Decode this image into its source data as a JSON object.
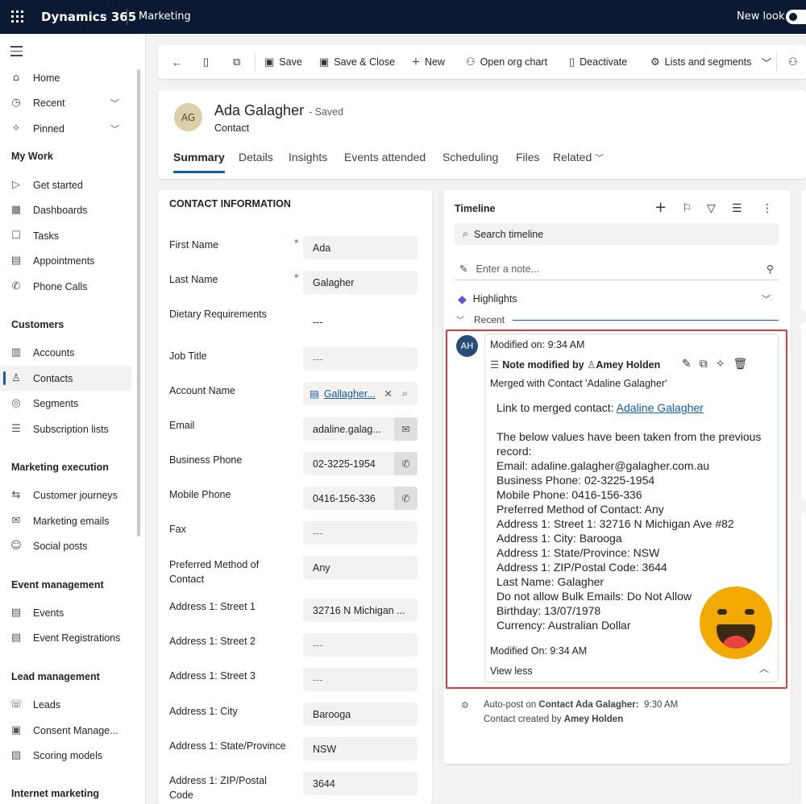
{
  "topbar": {
    "brand": "Dynamics 365",
    "app": "Marketing",
    "new_look": "New look"
  },
  "nav": {
    "items": [
      {
        "label": "Home",
        "icon": "home-icon"
      },
      {
        "label": "Recent",
        "icon": "clock-icon"
      },
      {
        "label": "Pinned",
        "icon": "pin-icon"
      }
    ],
    "groups": {
      "my_work": "My Work",
      "customers": "Customers",
      "marketing_execution": "Marketing execution",
      "event_management": "Event management",
      "lead_management": "Lead management",
      "internet_marketing": "Internet marketing"
    },
    "my_work": [
      "Get started",
      "Dashboards",
      "Tasks",
      "Appointments",
      "Phone Calls"
    ],
    "customers": [
      "Accounts",
      "Contacts",
      "Segments",
      "Subscription lists"
    ],
    "marketing_execution": [
      "Customer journeys",
      "Marketing emails",
      "Social posts"
    ],
    "event_management": [
      "Events",
      "Event Registrations"
    ],
    "lead_management": [
      "Leads",
      "Consent Manage...",
      "Scoring models"
    ]
  },
  "commandbar": {
    "save": "Save",
    "save_close": "Save & Close",
    "new": "New",
    "org_chart": "Open org chart",
    "deactivate": "Deactivate",
    "lists": "Lists and segments"
  },
  "record": {
    "initials": "AG",
    "name": "Ada Galagher",
    "status": "- Saved",
    "entity": "Contact",
    "tabs": [
      "Summary",
      "Details",
      "Insights",
      "Events attended",
      "Scheduling",
      "Files",
      "Related"
    ]
  },
  "contact_info": {
    "section_title": "CONTACT INFORMATION",
    "fields": [
      {
        "label": "First Name",
        "value": "Ada"
      },
      {
        "label": "Last Name",
        "value": "Galagher"
      },
      {
        "label": "Dietary Requirements",
        "value": "---"
      },
      {
        "label": "Job Title",
        "value": "---"
      },
      {
        "label": "Account Name",
        "value": "Gallagher..."
      },
      {
        "label": "Email",
        "value": "adaline.galag..."
      },
      {
        "label": "Business Phone",
        "value": "02-3225-1954"
      },
      {
        "label": "Mobile Phone",
        "value": "0416-156-336"
      },
      {
        "label": "Fax",
        "value": "---"
      },
      {
        "label": "Preferred Method of Contact",
        "value": "Any"
      },
      {
        "label": "Address 1: Street 1",
        "value": "32716 N Michigan ..."
      },
      {
        "label": "Address 1: Street 2",
        "value": "---"
      },
      {
        "label": "Address 1: Street 3",
        "value": "---"
      },
      {
        "label": "Address 1: City",
        "value": "Barooga"
      },
      {
        "label": "Address 1: State/Province",
        "value": "NSW"
      },
      {
        "label": "Address 1: ZIP/Postal Code",
        "value": "3644"
      }
    ]
  },
  "timeline": {
    "title": "Timeline",
    "search_placeholder": "Search timeline",
    "note_placeholder": "Enter a note...",
    "highlights": "Highlights",
    "recent": "Recent",
    "entry": {
      "initials": "AH",
      "modified": "Modified on: 9:34 AM",
      "by_prefix": "Note modified by",
      "author": "Amey Holden",
      "merged": "Merged with Contact 'Adaline Galagher'",
      "link_prefix": "Link to merged contact:",
      "link_text": "Adaline Galagher",
      "lines": [
        "The below values have been taken from the previous",
        "record:",
        "Email: adaline.galagher@galagher.com.au",
        "Business Phone: 02-3225-1954",
        "Mobile Phone: 0416-156-336",
        "Preferred Method of Contact: Any",
        "Address 1: Street 1: 32716 N Michigan Ave #82",
        "Address 1: City: Barooga",
        "Address 1: State/Province: NSW",
        "Address 1: ZIP/Postal Code: 3644",
        "Last Name: Galagher",
        "Do not allow Bulk Emails: Do Not Allow",
        "Birthday: 13/07/1978",
        "Currency: Australian Dollar"
      ],
      "footer": "Modified On: 9:34 AM",
      "view_less": "View less"
    },
    "autopost": {
      "prefix": "Auto-post on",
      "subject": "Contact Ada Galagher:",
      "time": "9:30 AM",
      "created_prefix": "Contact created by",
      "created_by": "Amey Holden"
    }
  },
  "colors": {
    "topbar": "#0b1a33",
    "accent": "#115ea3",
    "highlight_box": "#e03a3a",
    "smiley": "#f2a900"
  }
}
